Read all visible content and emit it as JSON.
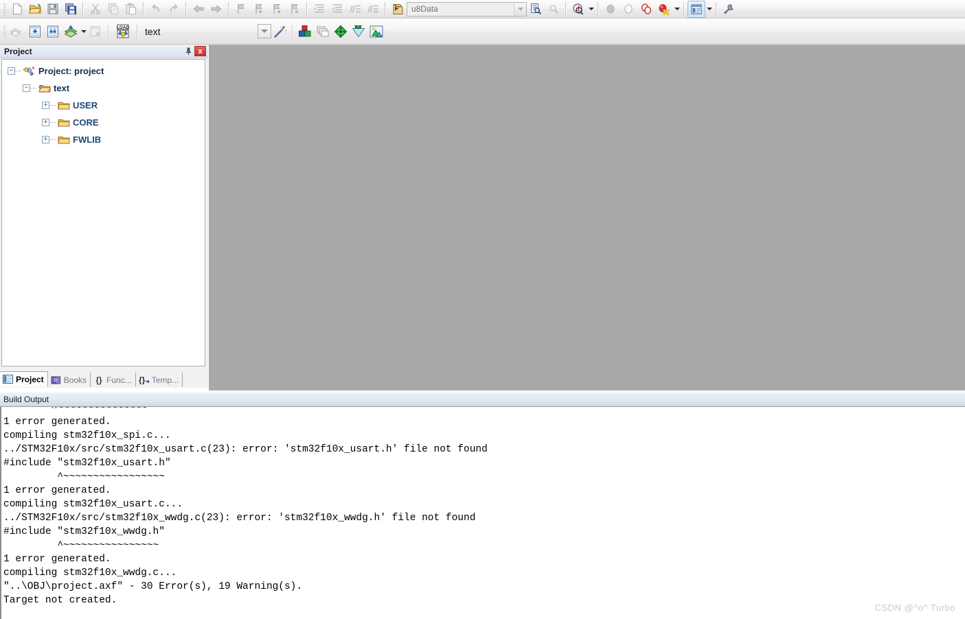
{
  "toolbars": {
    "main": {
      "groups": [
        {
          "name": "file",
          "buttons": [
            {
              "name": "new-file-icon",
              "label": "New",
              "enabled": true
            },
            {
              "name": "open-file-icon",
              "label": "Open",
              "enabled": true
            },
            {
              "name": "save-icon",
              "label": "Save",
              "enabled": true
            },
            {
              "name": "save-all-icon",
              "label": "Save All",
              "enabled": true
            }
          ]
        },
        {
          "name": "clipboard",
          "buttons": [
            {
              "name": "cut-icon",
              "label": "Cut",
              "enabled": false
            },
            {
              "name": "copy-icon",
              "label": "Copy",
              "enabled": false
            },
            {
              "name": "paste-icon",
              "label": "Paste",
              "enabled": false
            }
          ]
        },
        {
          "name": "history",
          "buttons": [
            {
              "name": "undo-icon",
              "label": "Undo",
              "enabled": false
            },
            {
              "name": "redo-icon",
              "label": "Redo",
              "enabled": false
            }
          ]
        },
        {
          "name": "navigate",
          "buttons": [
            {
              "name": "navigate-back-icon",
              "label": "Back",
              "enabled": false
            },
            {
              "name": "navigate-forward-icon",
              "label": "Forward",
              "enabled": false
            }
          ]
        },
        {
          "name": "bookmarks",
          "buttons": [
            {
              "name": "toggle-bookmark-icon",
              "label": "Insert/Remove Bookmark",
              "enabled": false
            },
            {
              "name": "previous-bookmark-icon",
              "label": "Previous Bookmark",
              "enabled": false
            },
            {
              "name": "next-bookmark-icon",
              "label": "Next Bookmark",
              "enabled": false
            },
            {
              "name": "clear-bookmarks-icon",
              "label": "Clear All Bookmarks",
              "enabled": false
            }
          ]
        },
        {
          "name": "indent",
          "buttons": [
            {
              "name": "indent-icon",
              "label": "Indent Selected Text",
              "enabled": false
            },
            {
              "name": "outdent-icon",
              "label": "Unindent Selected Text",
              "enabled": false
            },
            {
              "name": "comment-icon",
              "label": "Comment Selection",
              "enabled": false
            },
            {
              "name": "uncomment-icon",
              "label": "Uncomment Selection",
              "enabled": false
            }
          ]
        }
      ],
      "search": {
        "name": "find-in-files-combo",
        "value": "u8Data",
        "placeholder": ""
      },
      "search_buttons": [
        {
          "name": "find-in-files-icon",
          "label": "Find in Files",
          "enabled": true
        },
        {
          "name": "incremental-find-icon",
          "label": "Incremental Find",
          "enabled": false
        }
      ],
      "debug": [
        {
          "name": "start-debug-session-icon",
          "label": "Start/Stop Debug Session",
          "enabled": true,
          "dropdown": true
        },
        {
          "name": "insert-remove-breakpoint-icon",
          "label": "Insert/Remove Breakpoint",
          "enabled": false
        },
        {
          "name": "disable-breakpoint-icon",
          "label": "Enable/Disable Breakpoint",
          "enabled": false
        },
        {
          "name": "disable-all-breakpoints-icon",
          "label": "Disable All Breakpoints",
          "enabled": true
        },
        {
          "name": "kill-all-breakpoints-icon",
          "label": "Kill All Breakpoints",
          "enabled": true,
          "dropdown": true
        }
      ],
      "right": [
        {
          "name": "window-manager-icon",
          "label": "Manage Window Layout",
          "enabled": true,
          "active": true,
          "dropdown": true
        },
        {
          "name": "configure-icon",
          "label": "Configuration",
          "enabled": true
        }
      ]
    },
    "build": {
      "buttons": [
        {
          "name": "translate-file-icon",
          "label": "Translate Current File",
          "enabled": false
        },
        {
          "name": "build-target-icon",
          "label": "Build",
          "enabled": true
        },
        {
          "name": "rebuild-all-icon",
          "label": "Rebuild all target files",
          "enabled": true
        },
        {
          "name": "batch-build-icon",
          "label": "Batch Build",
          "enabled": true,
          "dropdown": true
        },
        {
          "name": "stop-build-icon",
          "label": "Stop Build",
          "enabled": false
        },
        {
          "name": "download-icon",
          "label": "Download",
          "enabled": true
        }
      ],
      "target": {
        "name": "select-target-combo",
        "value": "text"
      },
      "target_buttons": [
        {
          "name": "target-options-icon",
          "label": "Options for Target",
          "enabled": true
        },
        {
          "name": "manage-project-items-icon",
          "label": "Manage Project Items",
          "enabled": true
        },
        {
          "name": "manage-run-time-environment-icon",
          "label": "Manage Run-Time Environment",
          "enabled": true
        },
        {
          "name": "select-software-packs-icon",
          "label": "Select Software Packs",
          "enabled": true
        },
        {
          "name": "pack-installer-icon",
          "label": "Pack Installer",
          "enabled": true
        }
      ],
      "magic_wand": {
        "name": "target-options-wand-icon",
        "label": "Options for Target",
        "enabled": true
      }
    }
  },
  "project_panel": {
    "title": "Project",
    "pin_label": "Auto Hide",
    "close_label": "x",
    "tree": [
      {
        "level": 0,
        "label": "Project: project",
        "icon": "project-icon",
        "expander": "-"
      },
      {
        "level": 1,
        "label": "text",
        "icon": "target-folder-icon",
        "expander": "-"
      },
      {
        "level": 2,
        "label": "USER",
        "icon": "group-folder-icon",
        "expander": "+"
      },
      {
        "level": 2,
        "label": "CORE",
        "icon": "group-folder-icon",
        "expander": "+"
      },
      {
        "level": 2,
        "label": "FWLIB",
        "icon": "group-folder-icon",
        "expander": "+"
      }
    ],
    "tabs": [
      {
        "label": "Project",
        "icon": "project-tab-icon",
        "selected": true
      },
      {
        "label": "Books",
        "icon": "books-tab-icon",
        "selected": false
      },
      {
        "label": "Func...",
        "icon": "functions-tab-icon",
        "selected": false
      },
      {
        "label": "Temp...",
        "icon": "templates-tab-icon",
        "selected": false
      }
    ]
  },
  "build_output": {
    "title": "Build Output",
    "lines": [
      "        ^~~~~~~~~~~~~~~~",
      "1 error generated.",
      "compiling stm32f10x_spi.c...",
      "../STM32F10x/src/stm32f10x_usart.c(23): error: 'stm32f10x_usart.h' file not found",
      "#include \"stm32f10x_usart.h\"",
      "         ^~~~~~~~~~~~~~~~~~",
      "1 error generated.",
      "compiling stm32f10x_usart.c...",
      "../STM32F10x/src/stm32f10x_wwdg.c(23): error: 'stm32f10x_wwdg.h' file not found",
      "#include \"stm32f10x_wwdg.h\"",
      "         ^~~~~~~~~~~~~~~~~",
      "1 error generated.",
      "compiling stm32f10x_wwdg.c...",
      "\"..\\OBJ\\project.axf\" - 30 Error(s), 19 Warning(s).",
      "Target not created."
    ]
  },
  "watermark": "CSDN @^o^ Turbo",
  "colors": {
    "editor_background": "#a8a8a8",
    "panel_header": "#dde7f2",
    "close_button": "#c9302c",
    "tree_text": "#153a5b"
  }
}
